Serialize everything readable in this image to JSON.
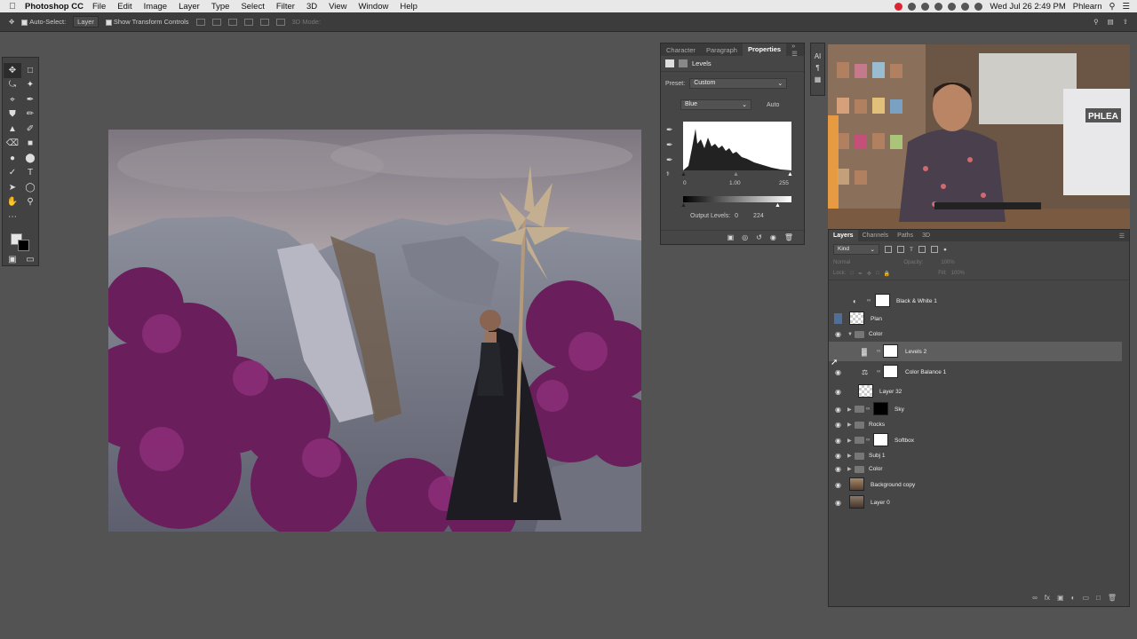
{
  "menubar": {
    "apple_icon": "apple-icon",
    "app_name": "Photoshop CC",
    "items": [
      "File",
      "Edit",
      "Image",
      "Layer",
      "Type",
      "Select",
      "Filter",
      "3D",
      "View",
      "Window",
      "Help"
    ],
    "clock": "Wed Jul 26  2:49 PM",
    "user": "Phlearn"
  },
  "options": {
    "auto_select_label": "Auto-Select:",
    "auto_select_value": "Layer",
    "transform_label": "Show Transform Controls",
    "mode_3d": "3D Mode:"
  },
  "properties": {
    "tabs": [
      "Character",
      "Paragraph",
      "Properties"
    ],
    "active_tab": "Properties",
    "title": "Levels",
    "preset_label": "Preset:",
    "preset_value": "Custom",
    "channel_value": "Blue",
    "auto_label": "Auto",
    "input_black": "0",
    "input_mid": "1.00",
    "input_white": "255",
    "output_label": "Output Levels:",
    "output_black": "0",
    "output_white": "224"
  },
  "layers": {
    "tabs": [
      "Layers",
      "Channels",
      "Paths",
      "3D"
    ],
    "active_tab": "Layers",
    "kind_label": "Kind",
    "blend_mode": "Normal",
    "opacity_label": "Opacity:",
    "opacity_value": "100%",
    "lock_label": "Lock:",
    "fill_label": "Fill:",
    "fill_value": "100%",
    "rows": [
      {
        "name": "Black & White 1"
      },
      {
        "name": "Plan"
      },
      {
        "name": "Color"
      },
      {
        "name": "Levels 2"
      },
      {
        "name": "Color Balance 1"
      },
      {
        "name": "Layer 32"
      },
      {
        "name": "Sky"
      },
      {
        "name": "Rocks"
      },
      {
        "name": "Softbox"
      },
      {
        "name": "Subj 1"
      },
      {
        "name": "Color"
      },
      {
        "name": "Background copy"
      },
      {
        "name": "Layer 0"
      }
    ]
  },
  "webcam": {
    "sign_text": "PHLEA"
  },
  "colors": {
    "ui_bg": "#535353",
    "panel_bg": "#464646",
    "selection_blue": "#4f6f9a",
    "menubar": "#e8e8e8"
  }
}
